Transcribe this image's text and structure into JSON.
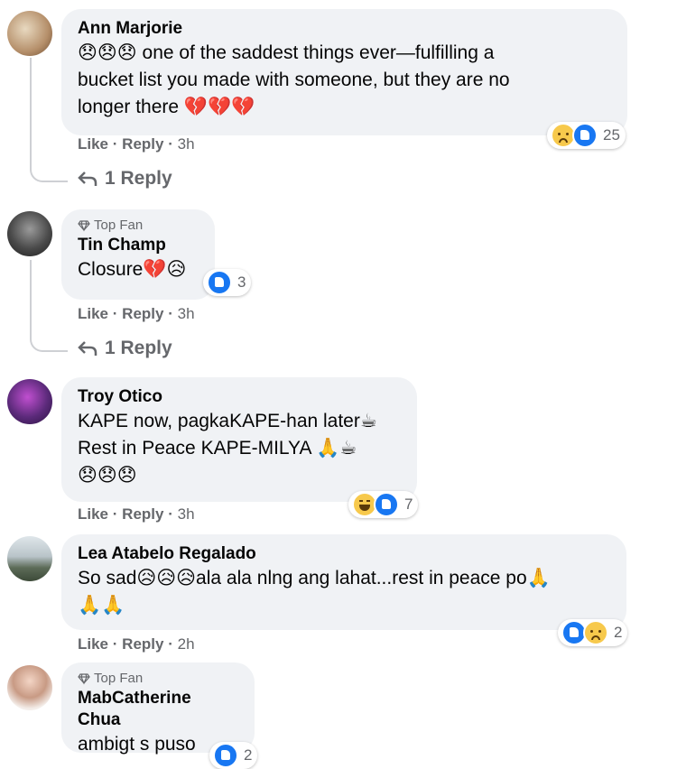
{
  "comments": [
    {
      "author": "Ann Marjorie",
      "line1": "😞😞😞 one of the saddest things ever—fulfilling a",
      "line2": "bucket list you made with someone, but they are no",
      "line3": "longer there 💔💔💔",
      "reaction_count": "25",
      "like": "Like",
      "reply": "Reply",
      "time": "3h",
      "replies_label": "1 Reply"
    },
    {
      "badge": "Top Fan",
      "author": "Tin Champ",
      "line1": "Closure💔😥",
      "reaction_count": "3",
      "like": "Like",
      "reply": "Reply",
      "time": "3h",
      "replies_label": "1 Reply"
    },
    {
      "author": "Troy Otico",
      "line1": "KAPE now, pagkaKAPE-han later☕",
      "line2": "Rest in Peace KAPE-MILYA 🙏☕",
      "line3": "😞😞😞",
      "reaction_count": "7",
      "like": "Like",
      "reply": "Reply",
      "time": "3h"
    },
    {
      "author": "Lea Atabelo Regalado",
      "line1": "So sad😥😥😥ala ala nlng ang lahat...rest in peace po🙏",
      "line2": "🙏🙏",
      "reaction_count": "2",
      "like": "Like",
      "reply": "Reply",
      "time": "2h"
    },
    {
      "badge": "Top Fan",
      "author": "MabCatherine Chua",
      "line1": "ambigt s puso",
      "reaction_count": "2"
    }
  ],
  "separator": "·",
  "reply_icon": "reply-arrow-icon",
  "colors": {
    "bubble": "#f0f2f5",
    "meta": "#65676b",
    "like_blue": "#1877f2"
  }
}
